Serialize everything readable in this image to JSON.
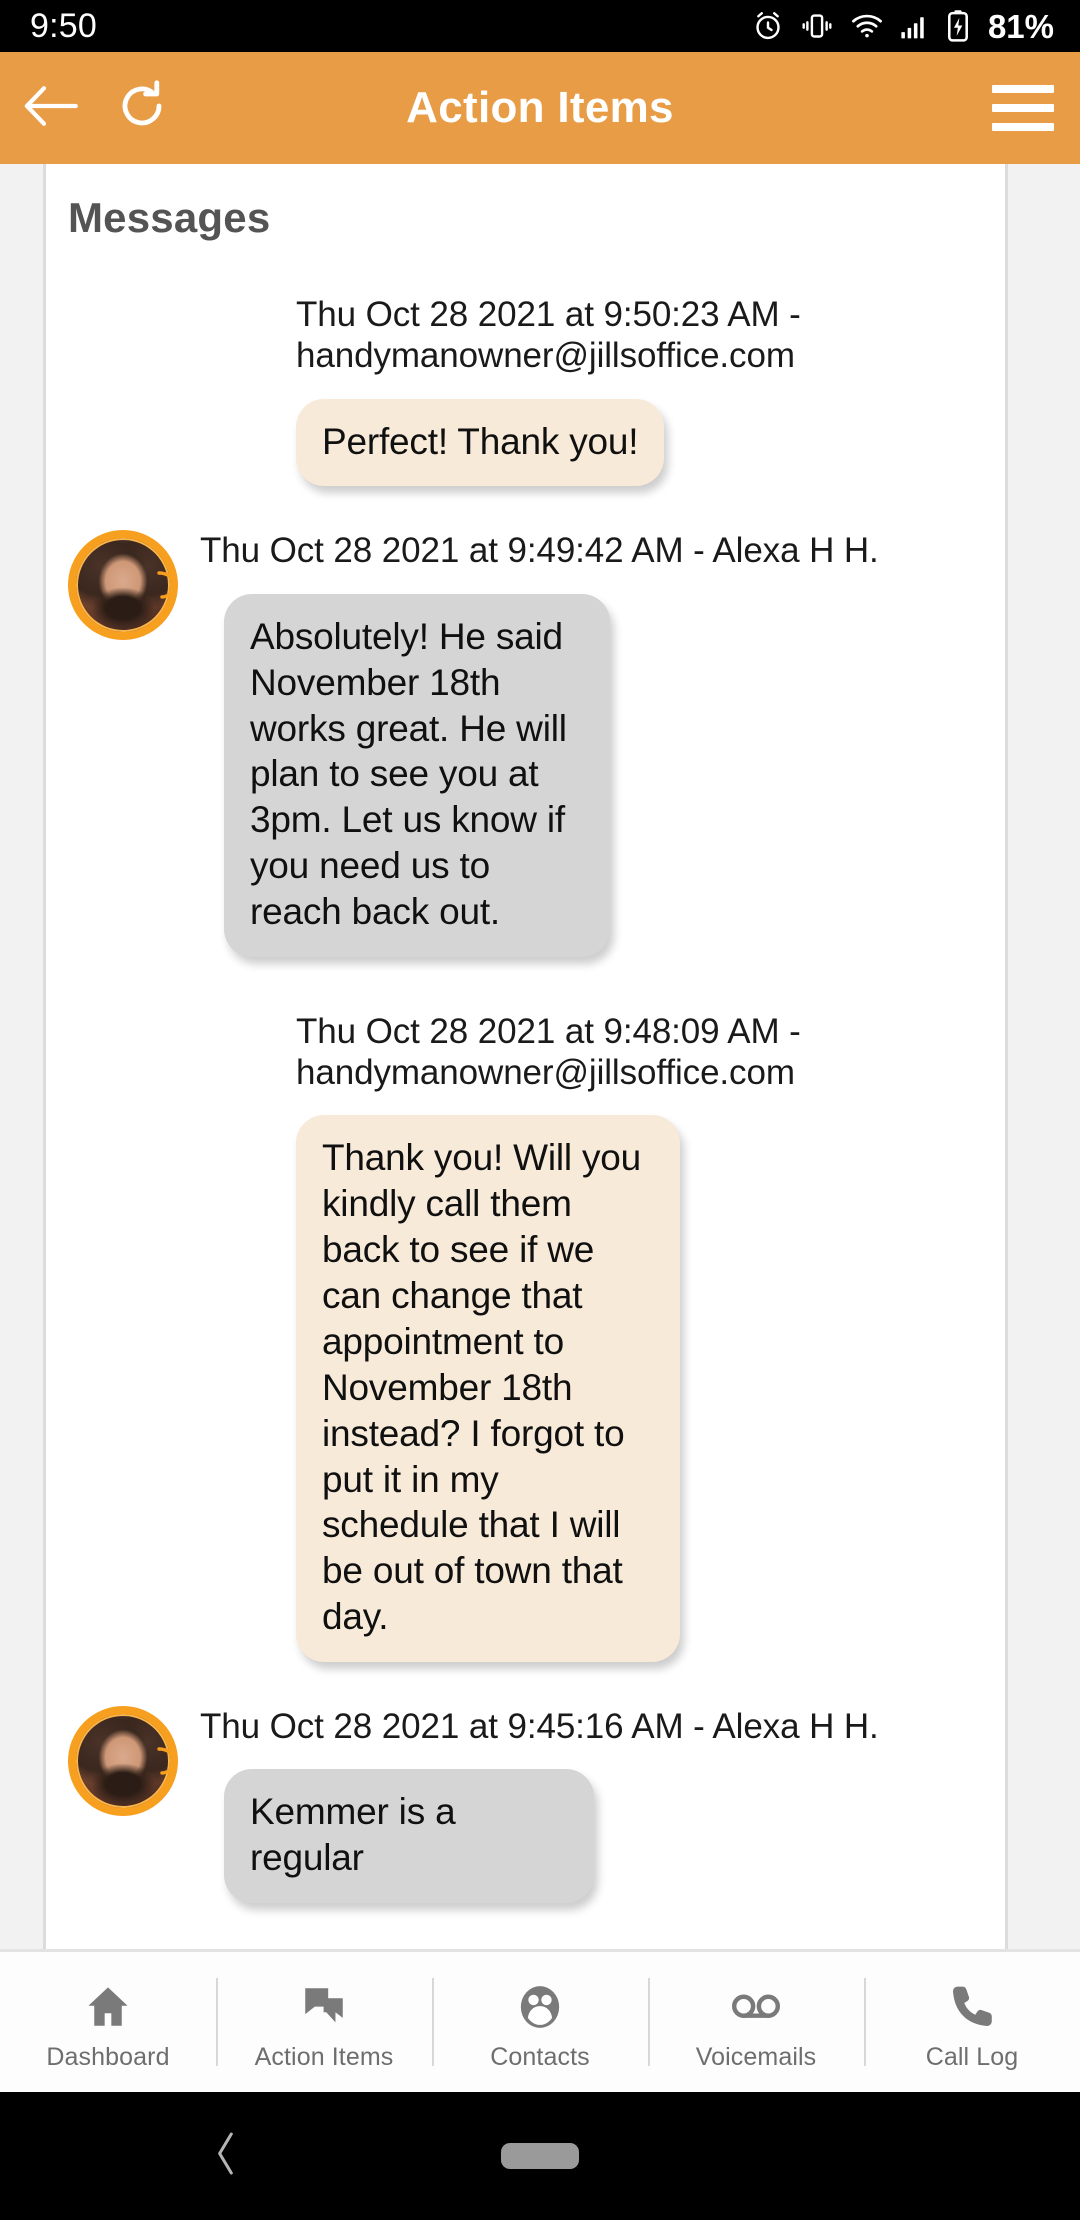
{
  "statusbar": {
    "clock": "9:50",
    "battery_percent": "81%",
    "icons": [
      "alarm-icon",
      "vibrate-icon",
      "wifi-icon",
      "signal-icon",
      "battery-charging-icon"
    ]
  },
  "appbar": {
    "title": "Action Items",
    "back_icon": "back-arrow-icon",
    "refresh_icon": "refresh-icon",
    "menu_icon": "hamburger-menu-icon",
    "accent_color": "#e89c45"
  },
  "content": {
    "section_title": "Messages",
    "messages": [
      {
        "direction": "out",
        "meta": "Thu Oct 28 2021 at 9:50:23 AM - handymanowner@jillsoffice.com",
        "text": "Perfect! Thank you!"
      },
      {
        "direction": "in",
        "meta": "Thu Oct 28 2021 at 9:49:42 AM - Alexa H H.",
        "sender": "Alexa H H.",
        "avatar": "user-avatar",
        "text": "Absolutely! He said November 18th works great. He will plan to see you at 3pm. Let us know if you need us to reach back out."
      },
      {
        "direction": "out",
        "meta": "Thu Oct 28 2021 at 9:48:09 AM - handymanowner@jillsoffice.com",
        "text": "Thank you! Will you kindly call them back to see if we can change that appointment to November 18th instead? I forgot to put it in my schedule that I will be out of town that day."
      },
      {
        "direction": "in",
        "meta": "Thu Oct 28 2021 at 9:45:16 AM - Alexa H H.",
        "sender": "Alexa H H.",
        "avatar": "user-avatar",
        "text": "Kemmer is a regular"
      }
    ],
    "bubble_color_in": "#d5d5d5",
    "bubble_color_out": "#f7ead9"
  },
  "bottomnav": {
    "items": [
      {
        "label": "Dashboard",
        "icon": "home-icon"
      },
      {
        "label": "Action Items",
        "icon": "chat-bubbles-icon"
      },
      {
        "label": "Contacts",
        "icon": "contacts-people-icon"
      },
      {
        "label": "Voicemails",
        "icon": "voicemail-icon"
      },
      {
        "label": "Call Log",
        "icon": "phone-icon"
      }
    ]
  },
  "androidnav": {
    "back_icon": "android-back-icon",
    "home_pill": "android-home-pill"
  }
}
